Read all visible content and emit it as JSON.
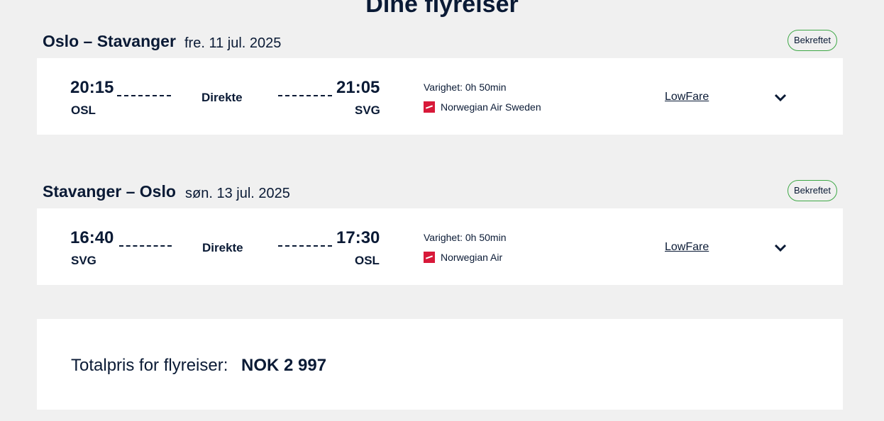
{
  "page": {
    "title": "Dine flyreiser"
  },
  "trips": [
    {
      "route": "Oslo – Stavanger",
      "date": "fre. 11 jul. 2025",
      "status": "Bekreftet",
      "departure_time": "20:15",
      "departure_code": "OSL",
      "stops": "Direkte",
      "arrival_time": "21:05",
      "arrival_code": "SVG",
      "duration": "Varighet: 0h 50min",
      "airline": "Norwegian Air Sweden",
      "fare": "LowFare",
      "expand_icon": "chevron-down-icon"
    },
    {
      "route": "Stavanger – Oslo",
      "date": "søn. 13 jul. 2025",
      "status": "Bekreftet",
      "departure_time": "16:40",
      "departure_code": "SVG",
      "stops": "Direkte",
      "arrival_time": "17:30",
      "arrival_code": "OSL",
      "duration": "Varighet: 0h 50min",
      "airline": "Norwegian Air",
      "fare": "LowFare",
      "expand_icon": "chevron-down-icon"
    }
  ],
  "total": {
    "label": "Totalpris for flyreiser:",
    "value": "NOK 2 997"
  },
  "colors": {
    "background": "#f0f0f0",
    "card": "#ffffff",
    "text": "#0a1a35",
    "badge_border": "#3fa847",
    "airline_brand": "#d81939"
  }
}
